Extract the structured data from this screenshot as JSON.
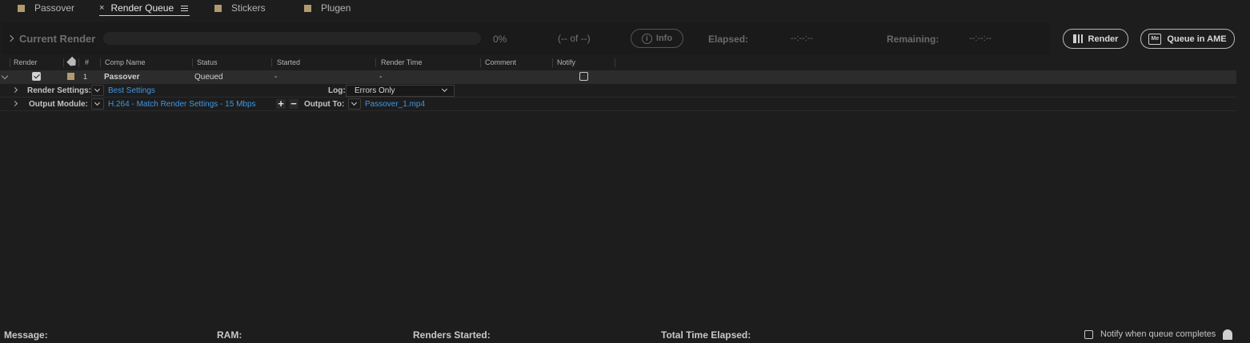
{
  "tabs": [
    {
      "label": "Passover",
      "swatch": "#b09a70"
    },
    {
      "label": "Render Queue",
      "active": true
    },
    {
      "label": "Stickers",
      "swatch": "#b09a70"
    },
    {
      "label": "Plugen",
      "swatch": "#b09a70"
    }
  ],
  "current_render": {
    "label": "Current Render",
    "progress_percent": 0,
    "percent_text": "0%",
    "count_text": "(-- of --)",
    "info_label": "Info",
    "elapsed_label": "Elapsed:",
    "elapsed_value": "--:--:--",
    "remaining_label": "Remaining:",
    "remaining_value": "--:--:--"
  },
  "actions": {
    "render_label": "Render",
    "queue_ame_label": "Queue in AME",
    "ame_icon_text": "Me"
  },
  "columns": [
    "Render",
    "#",
    "Comp Name",
    "Status",
    "Started",
    "Render Time",
    "Comment",
    "Notify"
  ],
  "queue": [
    {
      "render_checked": true,
      "label_color": "#b09a70",
      "number": "1",
      "comp_name": "Passover",
      "status": "Queued",
      "started": "-",
      "render_time": "-",
      "comment": "",
      "notify_checked": false,
      "render_settings_label": "Render Settings:",
      "render_settings_value": "Best Settings",
      "log_label": "Log:",
      "log_value": "Errors Only",
      "output_module_label": "Output Module:",
      "output_module_value": "H.264 - Match Render Settings -  15 Mbps",
      "output_to_label": "Output To:",
      "output_to_value": "Passover_1.mp4"
    }
  ],
  "status_bar": {
    "message_label": "Message:",
    "ram_label": "RAM:",
    "renders_started_label": "Renders Started:",
    "total_time_label": "Total Time Elapsed:",
    "notify_label": "Notify when queue completes",
    "notify_checked": false
  }
}
